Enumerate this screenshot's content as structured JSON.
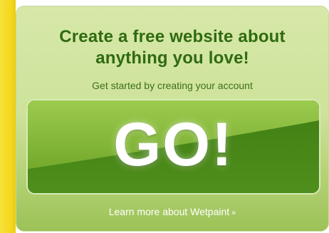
{
  "promo": {
    "headline_line1": "Create a free website about",
    "headline_line2": "anything you love!",
    "subline": "Get started by creating your account",
    "go_label": "GO!",
    "learn_more": "Learn more about Wetpaint",
    "learn_more_chevron": "»"
  },
  "colors": {
    "accent_yellow": "#f4d81e",
    "card_light": "#d7e8a8",
    "card_dark": "#9cc257",
    "headline_green": "#2f6a11",
    "button_green": "#4f8f1c"
  },
  "icons": {
    "chevron": "double-chevron-right-icon"
  }
}
